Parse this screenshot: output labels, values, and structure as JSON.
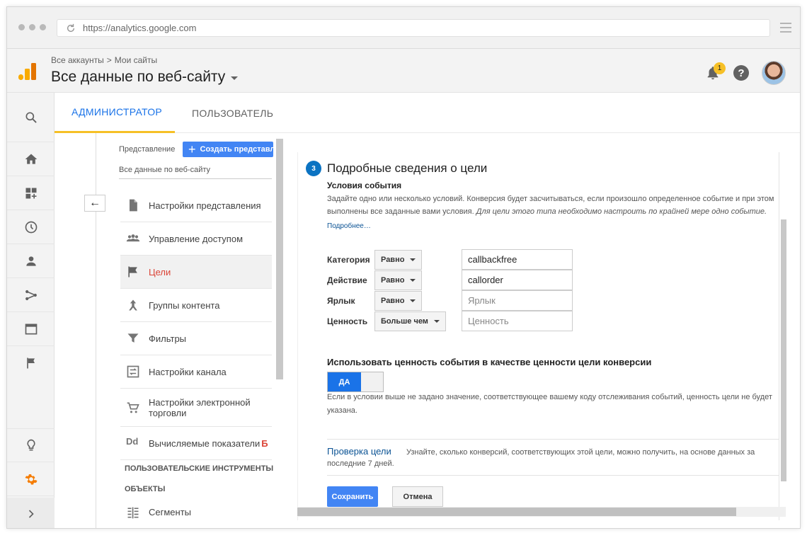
{
  "browser": {
    "url": "https://analytics.google.com"
  },
  "header": {
    "breadcrumb_account": "Все аккаунты",
    "breadcrumb_sep": ">",
    "breadcrumb_site": "Мои сайты",
    "title": "Все данные по веб-сайту",
    "notification_count": "1",
    "help_glyph": "?"
  },
  "tabs": {
    "admin": "АДМИНИСТРАТОР",
    "user": "ПОЛЬЗОВАТЕЛЬ"
  },
  "view_column": {
    "view_label": "Представление",
    "create_button": "Создать представл",
    "view_name": "Все данные по веб-сайту",
    "back_glyph": "←",
    "items": [
      {
        "label": "Настройки представления",
        "icon": "document-icon"
      },
      {
        "label": "Управление доступом",
        "icon": "people-icon"
      },
      {
        "label": "Цели",
        "icon": "flag-icon",
        "active": true
      },
      {
        "label": "Группы контента",
        "icon": "content-groups-icon"
      },
      {
        "label": "Фильтры",
        "icon": "filter-icon"
      },
      {
        "label": "Настройки канала",
        "icon": "channel-icon"
      },
      {
        "label": "Настройки электронной торговли",
        "icon": "cart-icon"
      },
      {
        "label": "Вычисляемые показатели",
        "suffix": "Б",
        "icon": "dd-icon"
      }
    ],
    "dd_glyph": "Dd",
    "section_custom_tools": "ПОЛЬЗОВАТЕЛЬСКИЕ ИНСТРУМЕНТЫ И",
    "section_objects": "ОБЪЕКТЫ",
    "segments": "Сегменты"
  },
  "goal_form": {
    "step": "3",
    "title": "Подробные сведения о цели",
    "subtitle": "Условия события",
    "description": "Задайте одно или несколько условий. Конверсия будет засчитываться, если произошло определенное событие и при этом выполнены все заданные вами условия.",
    "description_italic": "Для цели этого типа необходимо настроить по крайней мере одно событие.",
    "learn_more": "Подробнее…",
    "conditions": [
      {
        "label": "Категория",
        "operator": "Равно",
        "value": "callbackfree",
        "placeholder": ""
      },
      {
        "label": "Действие",
        "operator": "Равно",
        "value": "callorder",
        "placeholder": ""
      },
      {
        "label": "Ярлык",
        "operator": "Равно",
        "value": "",
        "placeholder": "Ярлык"
      },
      {
        "label": "Ценность",
        "operator": "Больше чем",
        "value": "",
        "placeholder": "Ценность"
      }
    ],
    "use_value_heading": "Использовать ценность события в качестве ценности цели конверсии",
    "toggle_on_label": "ДА",
    "toggle_note": "Если в условии выше не задано значение, соответствующее вашему коду отслеживания событий, ценность цели не будет указана.",
    "verify_link": "Проверка цели",
    "verify_text": "Узнайте, сколько конверсий, соответствующих этой цели, можно получить, на основе данных за последние 7 дней.",
    "save": "Сохранить",
    "cancel": "Отмена"
  },
  "colors": {
    "accent": "#1a73e8",
    "active_item": "#db4437",
    "tab_underline": "#f6c026",
    "settings_icon": "#f57c00"
  }
}
